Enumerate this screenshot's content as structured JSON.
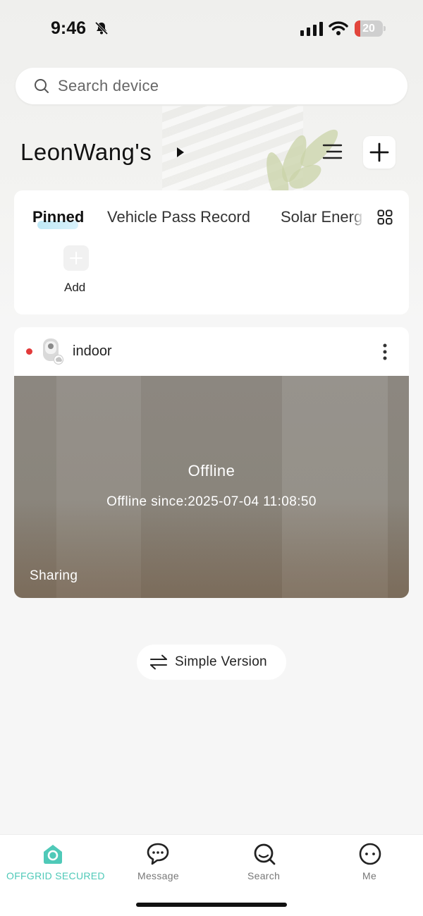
{
  "status_bar": {
    "time": "9:46",
    "battery_level": "20",
    "battery_fraction": 0.2
  },
  "search": {
    "placeholder": "Search device"
  },
  "home": {
    "name": "LeonWang's"
  },
  "tabs": [
    {
      "label": "Pinned",
      "active": true
    },
    {
      "label": "Vehicle Pass Record",
      "active": false
    },
    {
      "label": "Solar Energ",
      "active": false
    }
  ],
  "pinned": {
    "add_label": "Add"
  },
  "device": {
    "name": "indoor",
    "status": "Offline",
    "offline_since": "Offline since:2025-07-04 11:08:50",
    "sharing_label": "Sharing"
  },
  "simple_version": {
    "label": "Simple Version"
  },
  "bottom_nav": [
    {
      "label": "OFFGRID SECURED",
      "icon": "home-icon",
      "active": true
    },
    {
      "label": "Message",
      "icon": "message-icon",
      "active": false
    },
    {
      "label": "Search",
      "icon": "search-icon",
      "active": false
    },
    {
      "label": "Me",
      "icon": "me-icon",
      "active": false
    }
  ],
  "colors": {
    "accent": "#4fc9b8",
    "status_offline": "#e23a3a",
    "battery_low": "#e2453c"
  }
}
